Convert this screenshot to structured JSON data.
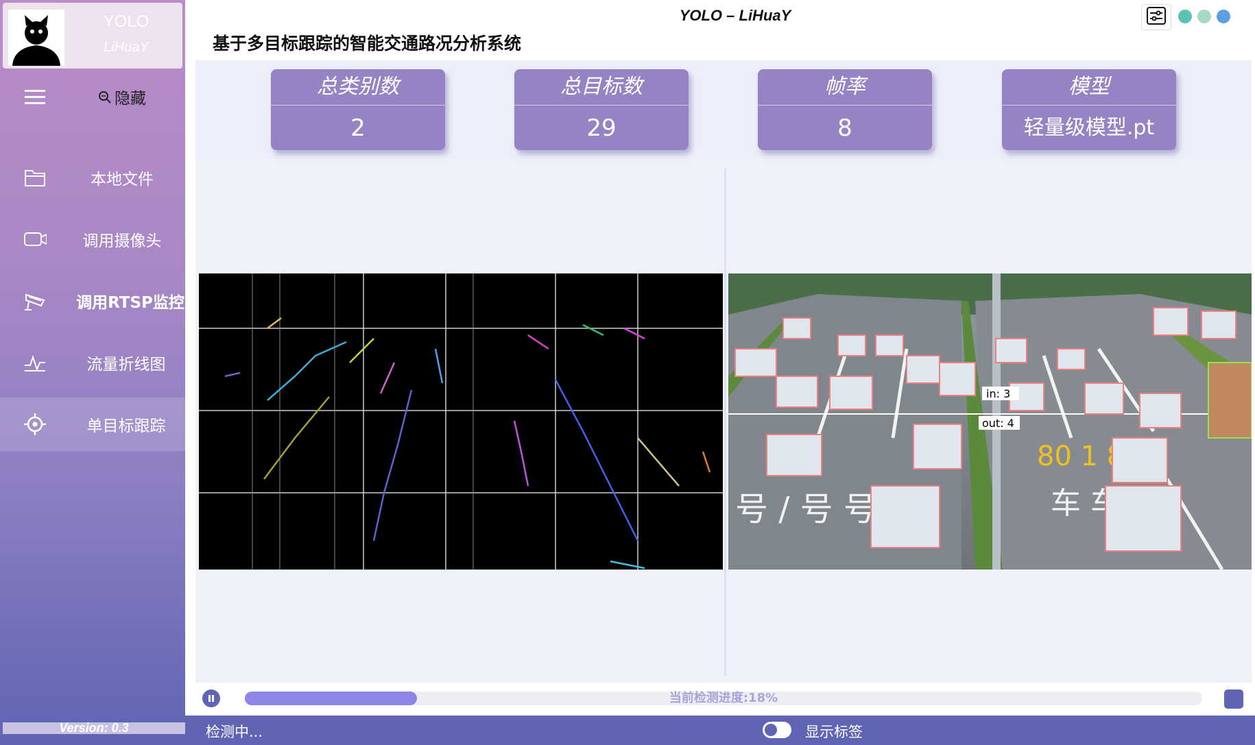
{
  "window": {
    "title": "YOLO  –  LiHuaY"
  },
  "profile": {
    "name": "YOLO",
    "subtitle": "LiHuaY"
  },
  "page_title": "基于多目标跟踪的智能交通路况分析系统",
  "sidebar": {
    "items": [
      {
        "label": "隐藏",
        "icon": "search-icon"
      },
      {
        "label": "本地文件",
        "icon": "folder-icon"
      },
      {
        "label": "调用摄像头",
        "icon": "camera-icon"
      },
      {
        "label": "调用RTSP监控",
        "icon": "cctv-icon"
      },
      {
        "label": "流量折线图",
        "icon": "pulse-icon"
      },
      {
        "label": "单目标跟踪",
        "icon": "target-icon"
      }
    ],
    "version": "Version: 0.3"
  },
  "stats": [
    {
      "title": "总类别数",
      "value": "2"
    },
    {
      "title": "总目标数",
      "value": "29"
    },
    {
      "title": "帧率",
      "value": "8"
    },
    {
      "title": "模型",
      "value": "轻量级模型.pt"
    }
  ],
  "counter": {
    "in_label": "in: 3",
    "out_label": "out: 4"
  },
  "progress": {
    "label": "当前检测进度:18%",
    "value": 0.18
  },
  "status": {
    "text": "检测中...",
    "toggle_label": "显示标签"
  },
  "colors": {
    "accent": "#5f64b4",
    "card": "#9583c4",
    "dot1": "#5cc1b6",
    "dot2": "#a7d8c4",
    "dot3": "#5aa0e0"
  }
}
